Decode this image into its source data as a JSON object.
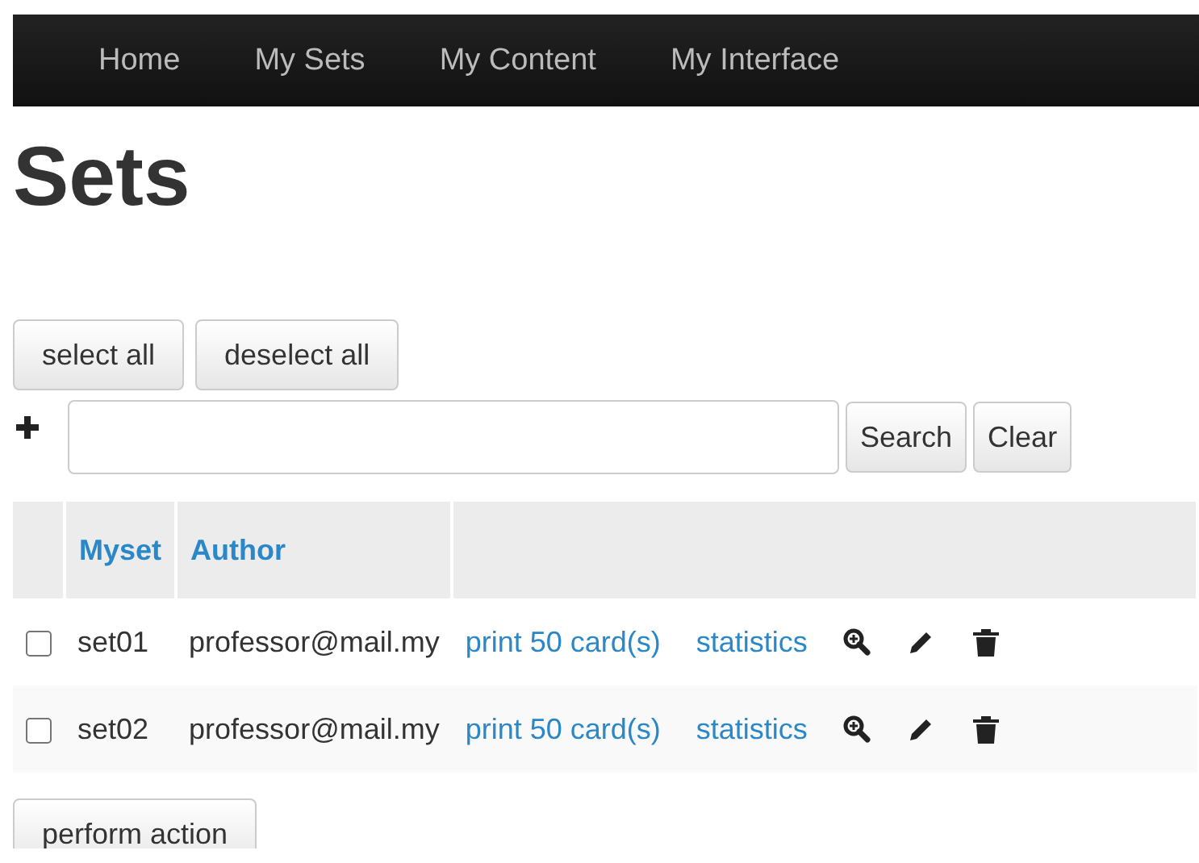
{
  "nav": {
    "items": [
      {
        "label": "Home"
      },
      {
        "label": "My Sets"
      },
      {
        "label": "My Content"
      },
      {
        "label": "My Interface"
      }
    ]
  },
  "heading": "Sets",
  "selection_buttons": [
    "select all",
    "deselect all"
  ],
  "search": {
    "buttons": [
      "Search",
      "Clear"
    ]
  },
  "table": {
    "columns": [
      "Myset",
      "Author"
    ],
    "rows": [
      {
        "checked": false,
        "set": "set01",
        "author": "professor@mail.my",
        "print": "print 50 card(s)",
        "stats": "statistics"
      },
      {
        "checked": false,
        "set": "set02",
        "author": "professor@mail.my",
        "print": "print 50 card(s)",
        "stats": "statistics"
      }
    ]
  },
  "action_button": "perform action"
}
